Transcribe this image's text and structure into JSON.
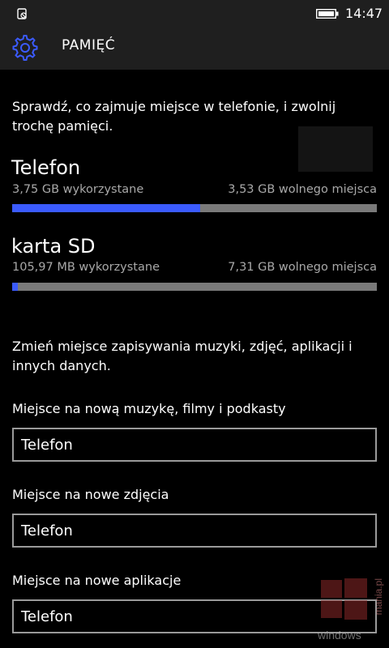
{
  "status_bar": {
    "time": "14:47",
    "left_icon": "no-sim-icon",
    "battery_icon": "battery-icon"
  },
  "header": {
    "icon": "gear-icon",
    "title": "PAMIĘĆ"
  },
  "intro": {
    "line1": "Sprawdź, co zajmuje miejsce w telefonie, i zwolnij",
    "line2": "trochę pamięci."
  },
  "storage": [
    {
      "name": "Telefon",
      "used": "3,75 GB wykorzystane",
      "free": "3,53 GB wolnego miejsca",
      "used_fraction": 0.515
    },
    {
      "name": "karta SD",
      "used": "105,97 MB wykorzystane",
      "free": "7,31 GB wolnego miejsca",
      "used_fraction": 0.015
    }
  ],
  "change_text": {
    "line1": "Zmień miejsce zapisywania muzyki, zdjęć, aplikacji i",
    "line2": "innych danych."
  },
  "settings": [
    {
      "label": "Miejsce na nową muzykę, filmy i podkasty",
      "value": "Telefon"
    },
    {
      "label": "Miejsce na nowe zdjęcia",
      "value": "Telefon"
    },
    {
      "label": "Miejsce na nowe aplikacje",
      "value": "Telefon"
    }
  ],
  "colors": {
    "accent": "#3b5bff",
    "bar_track": "#7a7a7a",
    "header_bg": "#1f1f1f"
  },
  "watermark": {
    "text": "windows",
    "side_text": "mania.pl"
  }
}
